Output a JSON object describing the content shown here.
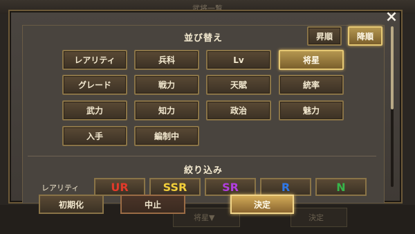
{
  "background": {
    "title": "武将一覧",
    "sort_label": "将星▼",
    "decide": "決定"
  },
  "sort": {
    "title": "並び替え",
    "order_asc": "昇順",
    "order_desc": "降順",
    "options": [
      "レアリティ",
      "兵科",
      "Lv",
      "将星",
      "グレード",
      "戦力",
      "天賦",
      "統率",
      "武力",
      "知力",
      "政治",
      "魅力",
      "入手",
      "編制中"
    ],
    "selected": "将星"
  },
  "filter": {
    "title": "絞り込み",
    "rarity_label": "レアリティ",
    "rarities": [
      {
        "label": "UR",
        "color": "#e23a2a"
      },
      {
        "label": "SSR",
        "color": "#f2cf3a"
      },
      {
        "label": "SR",
        "color": "#b23ee0"
      },
      {
        "label": "R",
        "color": "#2f78e8"
      },
      {
        "label": "N",
        "color": "#37b54a"
      }
    ]
  },
  "footer": {
    "reset": "初期化",
    "cancel": "中止",
    "confirm": "決定"
  },
  "icons": {
    "close": "close-icon"
  }
}
